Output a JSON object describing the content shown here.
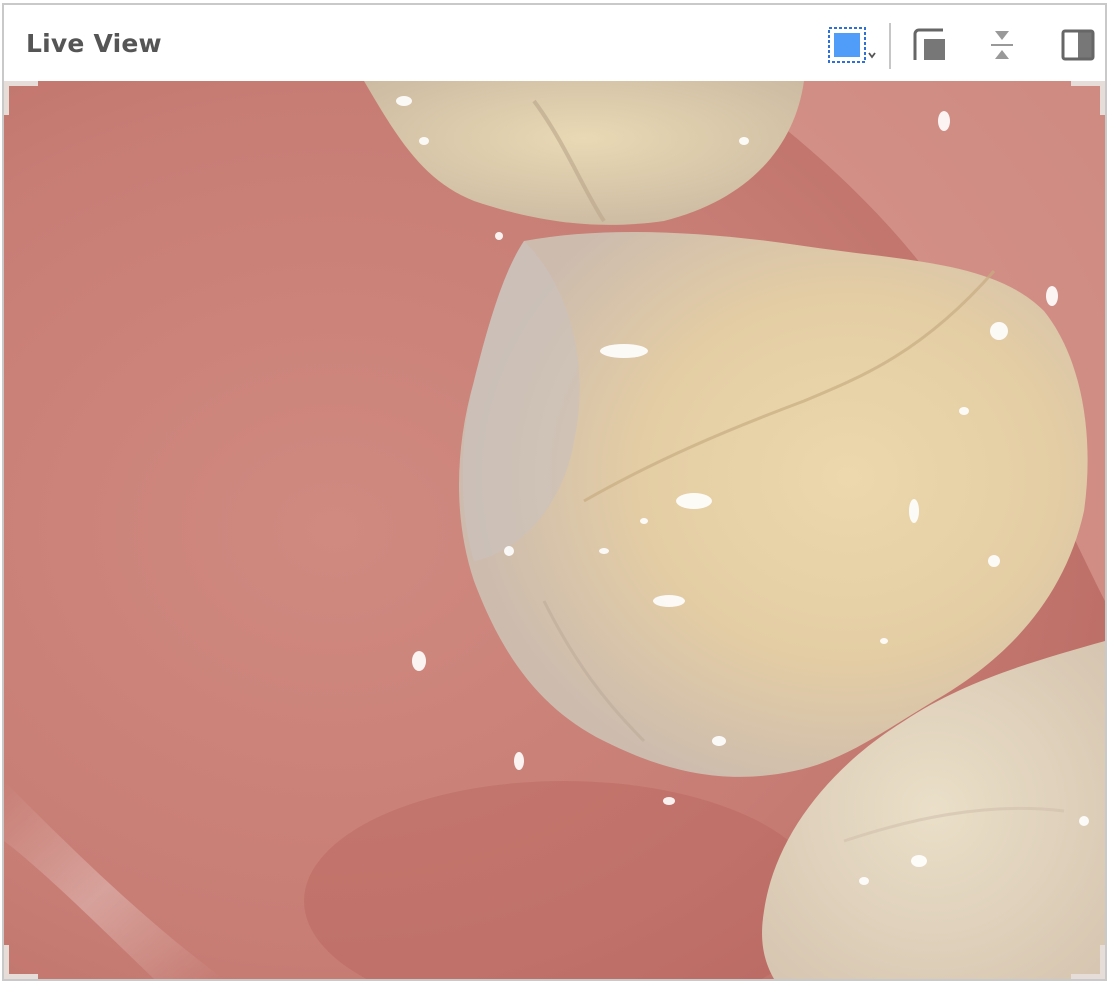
{
  "window": {
    "title": "Live View"
  },
  "toolbar": {
    "tools": [
      {
        "icon": "selection-rectangle-icon",
        "active": true,
        "has_dropdown": true
      },
      {
        "icon": "overlay-frame-icon",
        "active": false
      },
      {
        "icon": "flip-vertical-icon",
        "active": false
      },
      {
        "icon": "contrast-toggle-icon",
        "active": false
      }
    ]
  },
  "viewer": {
    "content": "intraoral-camera-image",
    "colors": {
      "gum": "#c98178",
      "tooth": "#e8d3a8",
      "highlight": "#ffffff",
      "accent": "#3d8af7"
    }
  }
}
